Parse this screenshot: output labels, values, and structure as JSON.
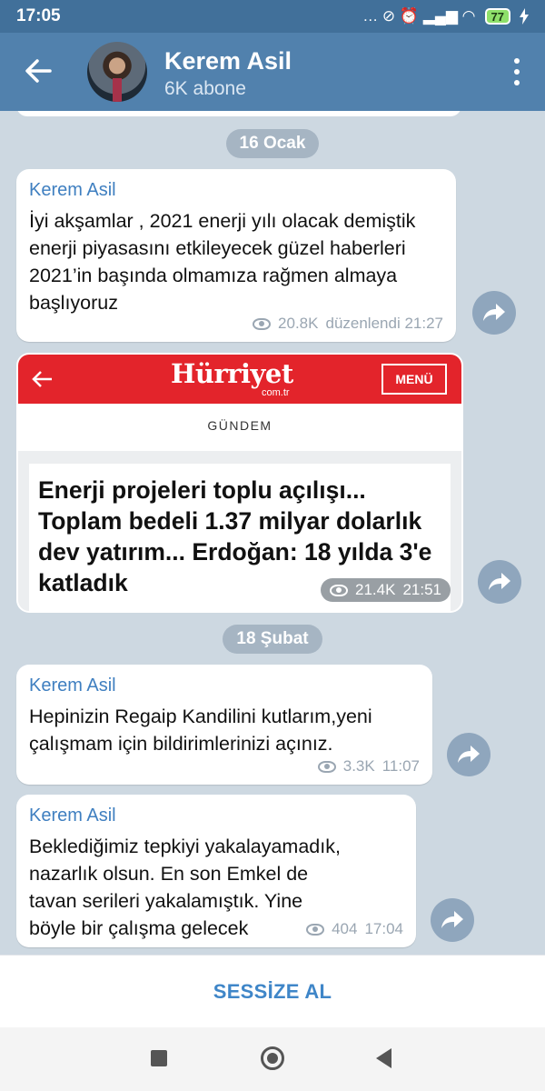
{
  "status_bar": {
    "time": "17:05",
    "indicators": "… ⊘ ⏰ ▂▄▆ ◠",
    "battery": "77",
    "charging_icon": "bolt"
  },
  "header": {
    "title": "Kerem Asil",
    "subtitle": "6K abone"
  },
  "messages": {
    "date1": "16 Ocak",
    "m1": {
      "sender": "Kerem Asil",
      "text": "İyi akşamlar , 2021 enerji yılı olacak demiştik enerji piyasasını etkileyecek güzel haberleri 2021’in başında olmamıza rağmen almaya başlıyoruz",
      "views": "20.8K",
      "time": "düzenlendi 21:27"
    },
    "m2": {
      "logo": "Hürriyet",
      "logo_sub": "com.tr",
      "menu": "MENÜ",
      "section": "GÜNDEM",
      "headline": "Enerji projeleri toplu açılışı... Toplam bedeli 1.37 milyar dolarlık dev yatırım... Erdoğan: 18 yılda 3'e katladık",
      "views": "21.4K",
      "time": "21:51"
    },
    "date2": "18 Şubat",
    "m3": {
      "sender": "Kerem Asil",
      "text": "Hepinizin Regaip Kandilini kutlarım,yeni çalışmam için bildirimlerinizi açınız.",
      "views": "3.3K",
      "time": "11:07"
    },
    "m4": {
      "sender": "Kerem Asil",
      "text": "Beklediğimiz tepkiyi yakalayamadık, nazarlık olsun. En son Emkel de tavan serileri yakalamıştık. Yine böyle bir çalışma gelecek",
      "views": "404",
      "time": "17:04"
    }
  },
  "bottom": {
    "mute_label": "SESSİZE AL"
  },
  "colors": {
    "header_bg": "#5181ad",
    "status_bg": "#41709a",
    "accent": "#3f86c8",
    "sender": "#3f7fc0",
    "hurriyet_red": "#e3242b"
  }
}
